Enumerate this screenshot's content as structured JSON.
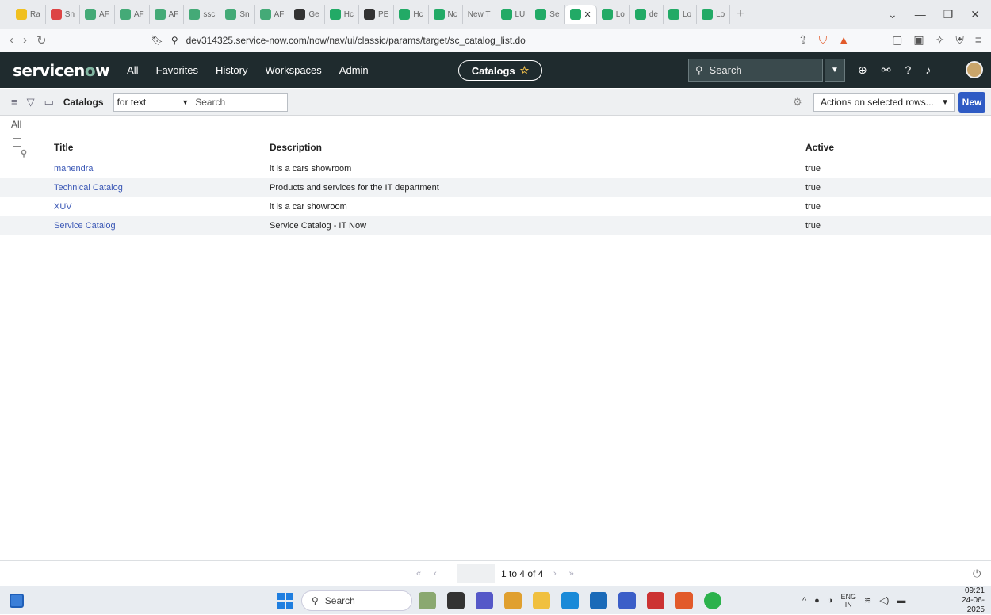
{
  "browser": {
    "tabs": [
      "Ra",
      "Sn",
      "AF",
      "AF",
      "AF",
      "ssc",
      "Sn",
      "AF",
      "Ge",
      "Hc",
      "PE",
      "Hc",
      "Nc",
      "New T",
      "LU",
      "Se",
      "",
      "Lo",
      "de",
      "Lo",
      "Lo"
    ],
    "url": "dev314325.service-now.com/now/nav/ui/classic/params/target/sc_catalog_list.do"
  },
  "header": {
    "logo_text": "servicen",
    "logo_o": "o",
    "logo_w": "w",
    "menu": [
      "All",
      "Favorites",
      "History",
      "Workspaces",
      "Admin"
    ],
    "context_pill": "Catalogs",
    "search_placeholder": "Search"
  },
  "listbar": {
    "title": "Catalogs",
    "field_option": "for text",
    "search_placeholder": "Search",
    "actions_label": "Actions on selected rows...",
    "new_label": "New"
  },
  "breadcrumb": "All",
  "table": {
    "columns": [
      "Title",
      "Description",
      "Active"
    ],
    "rows": [
      {
        "title": "mahendra",
        "description": "it is a cars showroom",
        "active": "true"
      },
      {
        "title": "Technical Catalog",
        "description": "Products and services for the IT department",
        "active": "true"
      },
      {
        "title": "XUV",
        "description": "it is a car showroom",
        "active": "true"
      },
      {
        "title": "Service Catalog",
        "description": "Service Catalog - IT Now",
        "active": "true"
      }
    ]
  },
  "pager": {
    "first_page": "1",
    "text": "to 4 of 4"
  },
  "taskbar": {
    "search_label": "Search",
    "lang_top": "ENG",
    "lang_bottom": "IN",
    "time": "09:21",
    "date": "24-06-2025"
  },
  "colors": {
    "header_bg": "#1f2b2e",
    "link": "#3a57b5",
    "new_button": "#2f5bc4"
  }
}
